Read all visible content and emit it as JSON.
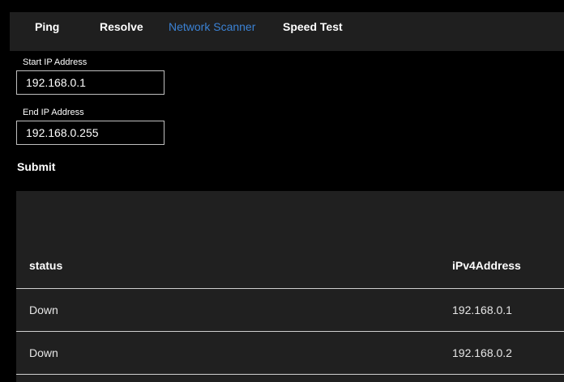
{
  "tabs": [
    {
      "label": "Ping",
      "active": false
    },
    {
      "label": "Resolve",
      "active": false
    },
    {
      "label": "Network Scanner",
      "active": true
    },
    {
      "label": "Speed Test",
      "active": false
    }
  ],
  "form": {
    "start_label": "Start IP Address",
    "start_value": "192.168.0.1",
    "end_label": "End IP Address",
    "end_value": "192.168.0.255",
    "submit_label": "Submit"
  },
  "table": {
    "headers": [
      "status",
      "iPv4Address"
    ],
    "rows": [
      [
        "Down",
        "192.168.0.1"
      ],
      [
        "Down",
        "192.168.0.2"
      ]
    ]
  },
  "colors": {
    "accent": "#3b82d4",
    "tabbar_bg": "#1f1f1f",
    "table_bg": "#202020",
    "page_bg": "#000000"
  }
}
